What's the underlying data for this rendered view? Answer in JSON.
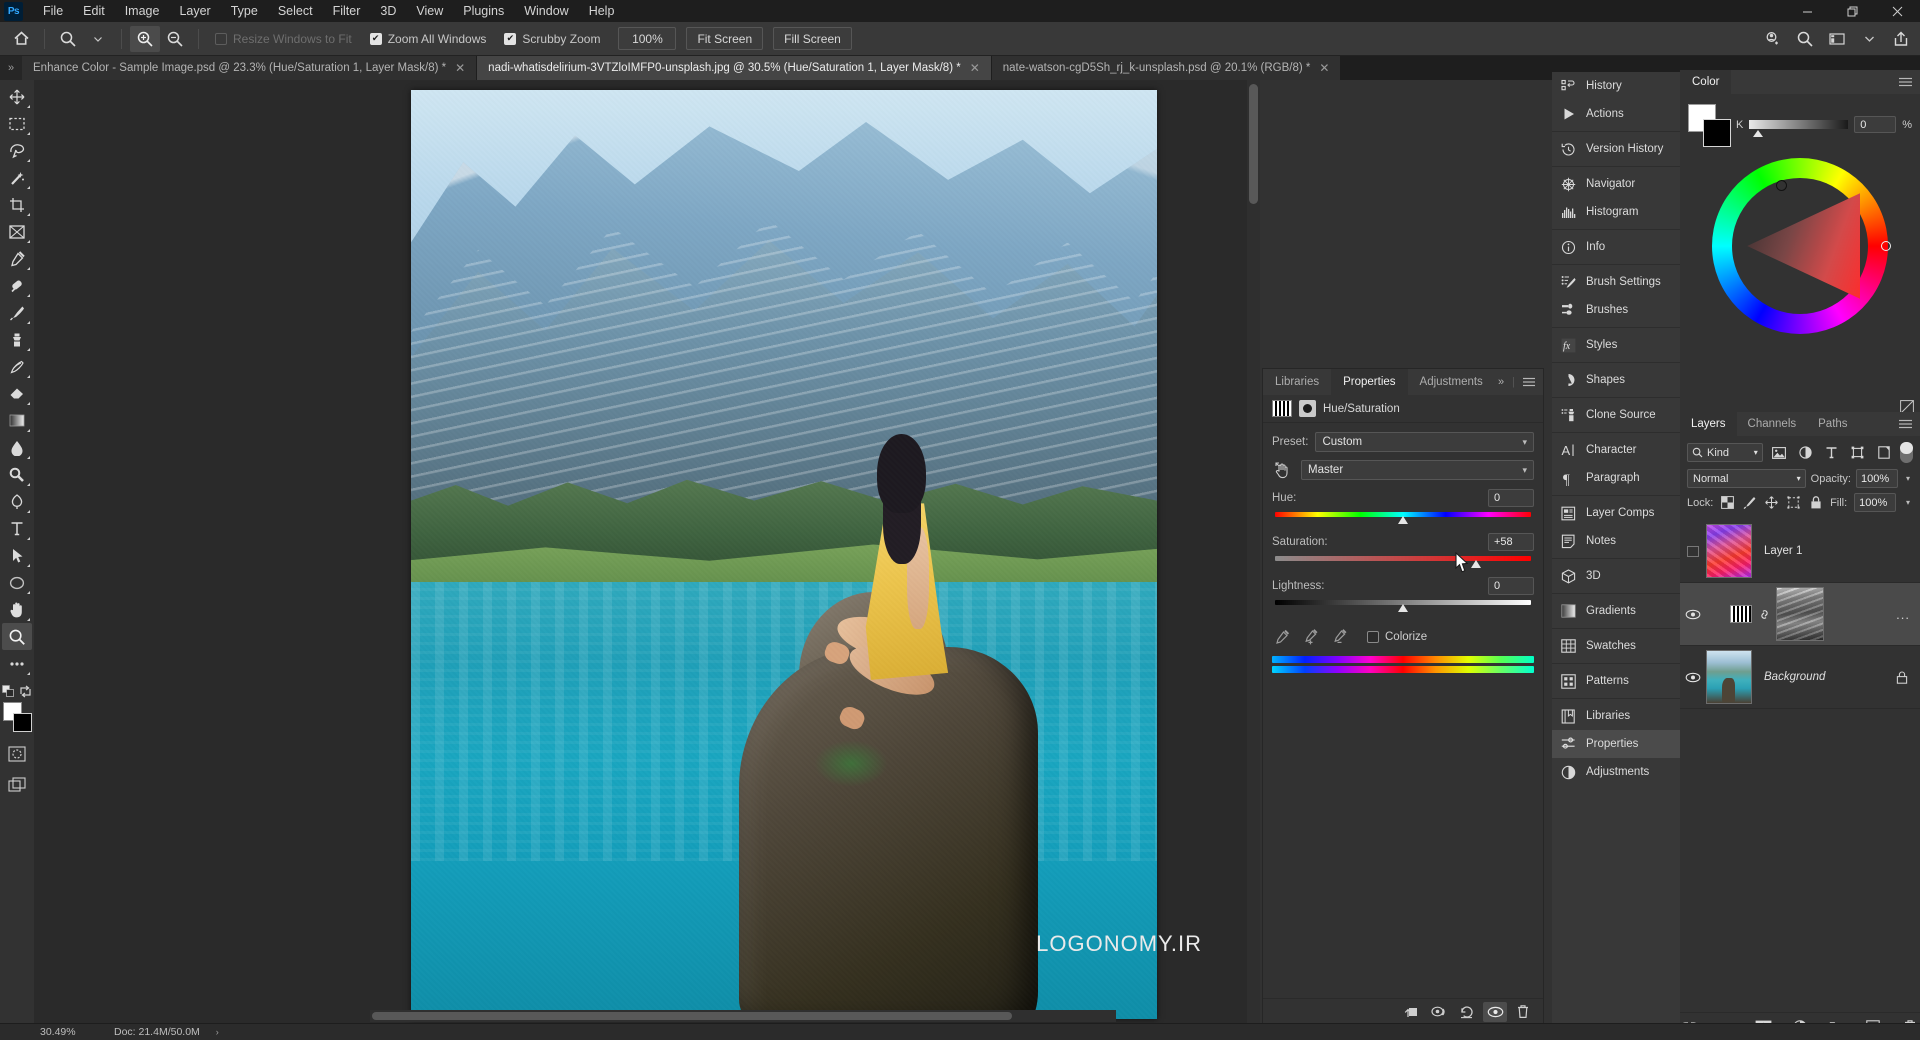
{
  "app": {
    "logo": "Ps"
  },
  "menubar": {
    "items": [
      "File",
      "Edit",
      "Image",
      "Layer",
      "Type",
      "Select",
      "Filter",
      "3D",
      "View",
      "Plugins",
      "Window",
      "Help"
    ],
    "window_controls": [
      "minimize",
      "restore",
      "close"
    ]
  },
  "options_bar": {
    "home_icon": "home-icon",
    "tool_icon": "zoom-tool-icon",
    "zoom_in_icon": "zoom-in-icon",
    "zoom_out_icon": "zoom-out-icon",
    "resize_windows_label": "Resize Windows to Fit",
    "resize_windows_checked": false,
    "zoom_all_label": "Zoom All Windows",
    "zoom_all_checked": true,
    "scrubby_label": "Scrubby Zoom",
    "scrubby_checked": true,
    "zoom_percent_label": "100%",
    "fit_screen_label": "Fit Screen",
    "fill_screen_label": "Fill Screen",
    "right_icons": [
      "help-bubble-icon",
      "search-icon",
      "workspace-icon",
      "chevron-down-icon",
      "share-icon"
    ]
  },
  "tabs": {
    "collapse_icon": "chevron-expand-icon",
    "items": [
      {
        "label": "Enhance Color - Sample Image.psd @ 23.3% (Hue/Saturation 1, Layer Mask/8) *",
        "active": false
      },
      {
        "label": "nadi-whatisdelirium-3VTZloIMFP0-unsplash.jpg @ 30.5% (Hue/Saturation 1, Layer Mask/8) *",
        "active": true
      },
      {
        "label": "nate-watson-cgD5Sh_rj_k-unsplash.psd @ 20.1% (RGB/8) *",
        "active": false
      }
    ]
  },
  "toolbar": {
    "tools": [
      {
        "name": "move-tool",
        "selected": false
      },
      {
        "name": "marquee-tool",
        "selected": false
      },
      {
        "name": "lasso-tool",
        "selected": false
      },
      {
        "name": "magic-wand-tool",
        "selected": false
      },
      {
        "name": "crop-tool",
        "selected": false
      },
      {
        "name": "frame-tool",
        "selected": false
      },
      {
        "name": "eyedropper-tool",
        "selected": false
      },
      {
        "name": "healing-brush-tool",
        "selected": false
      },
      {
        "name": "brush-tool",
        "selected": false
      },
      {
        "name": "clone-stamp-tool",
        "selected": false
      },
      {
        "name": "history-brush-tool",
        "selected": false
      },
      {
        "name": "eraser-tool",
        "selected": false
      },
      {
        "name": "gradient-tool",
        "selected": false
      },
      {
        "name": "blur-tool",
        "selected": false
      },
      {
        "name": "dodge-tool",
        "selected": false
      },
      {
        "name": "pen-tool",
        "selected": false
      },
      {
        "name": "type-tool",
        "selected": false
      },
      {
        "name": "path-selection-tool",
        "selected": false
      },
      {
        "name": "ellipse-tool",
        "selected": false
      },
      {
        "name": "hand-tool",
        "selected": false
      },
      {
        "name": "zoom-tool",
        "selected": true
      },
      {
        "name": "more-tools",
        "selected": false
      }
    ],
    "foreground_color": "#ffffff",
    "background_color": "#000000",
    "quick_mask_icon": "quick-mask-icon",
    "screen_mode_icon": "screen-mode-icon"
  },
  "canvas": {
    "watermark": "LOGONOMY.IR",
    "document_title": "nadi-whatisdelirium-3VTZloIMFP0-unsplash.jpg"
  },
  "properties_panel": {
    "tabs": [
      {
        "label": "Libraries",
        "active": false
      },
      {
        "label": "Properties",
        "active": true
      },
      {
        "label": "Adjustments",
        "active": false
      }
    ],
    "overflow_label": "»",
    "menu_icon": "panel-menu-icon",
    "header_title": "Hue/Saturation",
    "adjustment_thumb_icon": "hue-saturation-thumb-icon",
    "mask_thumb_icon": "layer-mask-thumb-icon",
    "preset_label": "Preset:",
    "preset_value": "Custom",
    "channel_value": "Master",
    "hand_icon": "targeted-adjustment-icon",
    "hue_label": "Hue:",
    "hue_value": "0",
    "hue_knob_pct": 50,
    "saturation_label": "Saturation:",
    "saturation_value": "+58",
    "saturation_knob_pct": 78,
    "lightness_label": "Lightness:",
    "lightness_value": "0",
    "lightness_knob_pct": 50,
    "eyedropper_icons": [
      "eyedropper-icon",
      "eyedropper-add-icon",
      "eyedropper-subtract-icon"
    ],
    "colorize_label": "Colorize",
    "colorize_checked": false,
    "footer_icons": [
      "clip-to-layer-icon",
      "view-previous-state-icon",
      "reset-icon",
      "toggle-visibility-icon",
      "delete-icon"
    ]
  },
  "dock": {
    "groups": [
      [
        {
          "label": "History",
          "icon": "history-icon",
          "selected": false
        },
        {
          "label": "Actions",
          "icon": "actions-play-icon",
          "selected": false
        }
      ],
      [
        {
          "label": "Version History",
          "icon": "version-history-clock-icon",
          "selected": false
        }
      ],
      [
        {
          "label": "Navigator",
          "icon": "navigator-icon",
          "selected": false
        },
        {
          "label": "Histogram",
          "icon": "histogram-icon",
          "selected": false
        }
      ],
      [
        {
          "label": "Info",
          "icon": "info-circle-icon",
          "selected": false
        }
      ],
      [
        {
          "label": "Brush Settings",
          "icon": "brush-settings-icon",
          "selected": false
        },
        {
          "label": "Brushes",
          "icon": "brushes-icon",
          "selected": false
        }
      ],
      [
        {
          "label": "Styles",
          "icon": "fx-styles-icon",
          "selected": false
        }
      ],
      [
        {
          "label": "Shapes",
          "icon": "shapes-icon",
          "selected": false
        }
      ],
      [
        {
          "label": "Clone Source",
          "icon": "clone-source-icon",
          "selected": false
        }
      ],
      [
        {
          "label": "Character",
          "icon": "character-icon",
          "selected": false
        },
        {
          "label": "Paragraph",
          "icon": "paragraph-icon",
          "selected": false
        }
      ],
      [
        {
          "label": "Layer Comps",
          "icon": "layer-comps-icon",
          "selected": false
        },
        {
          "label": "Notes",
          "icon": "notes-icon",
          "selected": false
        }
      ],
      [
        {
          "label": "3D",
          "icon": "cube-3d-icon",
          "selected": false
        }
      ],
      [
        {
          "label": "Gradients",
          "icon": "gradients-icon",
          "selected": false
        }
      ],
      [
        {
          "label": "Swatches",
          "icon": "swatches-grid-icon",
          "selected": false
        }
      ],
      [
        {
          "label": "Patterns",
          "icon": "patterns-icon",
          "selected": false
        }
      ],
      [
        {
          "label": "Libraries",
          "icon": "libraries-book-icon",
          "selected": false
        },
        {
          "label": "Properties",
          "icon": "properties-sliders-icon",
          "selected": true
        },
        {
          "label": "Adjustments",
          "icon": "adjustments-half-circle-icon",
          "selected": false
        }
      ]
    ]
  },
  "color_panel": {
    "tab_label": "Color",
    "menu_icon": "panel-menu-icon",
    "foreground_color": "#ffffff",
    "background_color": "#000000",
    "channel_letter": "K",
    "channel_value": "0",
    "channel_unit": "%",
    "wheel_icon": "color-wheel"
  },
  "layers_panel": {
    "tabs": [
      {
        "label": "Layers",
        "active": true
      },
      {
        "label": "Channels",
        "active": false
      },
      {
        "label": "Paths",
        "active": false
      }
    ],
    "menu_icon": "panel-menu-icon",
    "filter_kind_label": "Kind",
    "filter_icons": [
      "filter-pixel-icon",
      "filter-adjustment-icon",
      "filter-type-icon",
      "filter-shape-icon",
      "filter-smart-object-icon"
    ],
    "filter_toggle_on": true,
    "blend_mode": "Normal",
    "opacity_label": "Opacity:",
    "opacity_value": "100%",
    "lock_label": "Lock:",
    "lock_icons": [
      "lock-transparent-pixels-icon",
      "lock-image-pixels-icon",
      "lock-position-icon",
      "lock-artboard-icon",
      "lock-all-icon"
    ],
    "fill_label": "Fill:",
    "fill_value": "100%",
    "layers": [
      {
        "name": "Layer 1",
        "visible": false,
        "locked": false,
        "selected": false,
        "italic": false,
        "thumb": "psychedelic"
      },
      {
        "name": "",
        "visible": true,
        "locked": false,
        "selected": true,
        "italic": false,
        "thumb": "adjustment-mask",
        "linked": true,
        "overflow": "..."
      },
      {
        "name": "Background",
        "visible": true,
        "locked": true,
        "selected": false,
        "italic": true,
        "thumb": "photo"
      }
    ],
    "footer_icons": [
      "link-layers-icon",
      "add-layer-style-fx-icon",
      "add-layer-mask-icon",
      "new-adjustment-layer-icon",
      "new-group-icon",
      "new-layer-icon",
      "delete-layer-icon"
    ]
  },
  "status_bar": {
    "zoom": "30.49%",
    "doc_info": "Doc: 21.4M/50.0M",
    "chevron": "›"
  }
}
